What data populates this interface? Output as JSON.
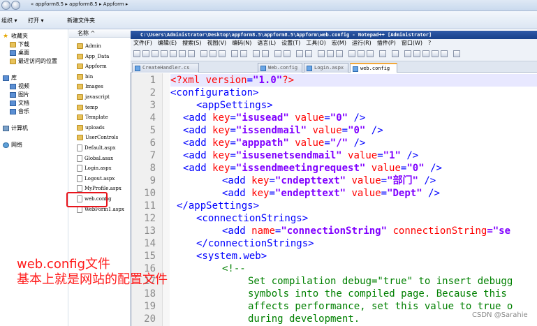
{
  "explorer": {
    "path": "« appform8.5 ▸ appform8.5 ▸ Appform ▸",
    "toolbar": {
      "organize": "组织 ▾",
      "open": "打开 ▾",
      "new_folder": "新建文件夹"
    },
    "nav": [
      {
        "label": "收藏夹",
        "icon": "star-icon"
      },
      {
        "label": "下载",
        "icon": "folder-icon"
      },
      {
        "label": "桌面",
        "icon": "folder-icon"
      },
      {
        "label": "最近访问的位置",
        "icon": "folder-icon"
      },
      {
        "label": "库",
        "icon": "library-icon"
      },
      {
        "label": "视频",
        "icon": "folder-icon"
      },
      {
        "label": "图片",
        "icon": "folder-icon"
      },
      {
        "label": "文档",
        "icon": "folder-icon"
      },
      {
        "label": "音乐",
        "icon": "folder-icon"
      },
      {
        "label": "计算机",
        "icon": "computer-icon"
      },
      {
        "label": "网络",
        "icon": "network-icon"
      }
    ],
    "file_header": "名称 ^",
    "files": [
      {
        "name": "Admin",
        "kind": "folder"
      },
      {
        "name": "App_Data",
        "kind": "folder"
      },
      {
        "name": "Appform",
        "kind": "folder"
      },
      {
        "name": "bin",
        "kind": "folder"
      },
      {
        "name": "Images",
        "kind": "folder"
      },
      {
        "name": "javascript",
        "kind": "folder"
      },
      {
        "name": "temp",
        "kind": "folder"
      },
      {
        "name": "Template",
        "kind": "folder"
      },
      {
        "name": "uploads",
        "kind": "folder"
      },
      {
        "name": "UserControls",
        "kind": "folder"
      },
      {
        "name": "Default.aspx",
        "kind": "file"
      },
      {
        "name": "Global.asax",
        "kind": "file"
      },
      {
        "name": "Login.aspx",
        "kind": "file"
      },
      {
        "name": "Logout.aspx",
        "kind": "file"
      },
      {
        "name": "MyProfile.aspx",
        "kind": "file"
      },
      {
        "name": "web.config",
        "kind": "file"
      },
      {
        "name": "WebForm1.aspx",
        "kind": "file"
      }
    ]
  },
  "notepad": {
    "title": "C:\\Users\\Administrator\\Desktop\\appform8.5\\appform8.5\\Appform\\web.config - Notepad++ [Administrator]",
    "menu": [
      "文件(F)",
      "编辑(E)",
      "搜索(S)",
      "视图(V)",
      "编码(N)",
      "语言(L)",
      "设置(T)",
      "工具(O)",
      "宏(M)",
      "运行(R)",
      "插件(P)",
      "窗口(W)",
      "?"
    ],
    "tabs": [
      {
        "label": "CreateHandler.cs",
        "active": false
      },
      {
        "label": "Web.config",
        "active": false
      },
      {
        "label": "Login.aspx",
        "active": false
      },
      {
        "label": "web.config",
        "active": true
      }
    ],
    "line_numbers": [
      "1",
      "2",
      "3",
      "4",
      "5",
      "6",
      "7",
      "8",
      "9",
      "10",
      "11",
      "12",
      "13",
      "14",
      "15",
      "16",
      "17",
      "18",
      "19",
      "20"
    ]
  },
  "caption": {
    "line1": "web.config文件",
    "line2": "基本上就是网站的配置文件"
  },
  "watermark": "CSDN @Sarahie",
  "code": {
    "l1_a": "<?xml ",
    "l1_b": "version",
    "l1_c": "=",
    "l1_d": "\"1.0\"",
    "l1_e": "?>",
    "l2": "<configuration>",
    "l3": "<appSettings>",
    "l4_k": "\"isusead\"",
    "l4_v": "\"0\"",
    "l5_k": "\"issendmail\"",
    "l5_v": "\"0\"",
    "l6_k": "\"apppath\"",
    "l6_v": "\"/\"",
    "l7_k": "\"isusenetsendmail\"",
    "l7_v": "\"1\"",
    "l8_k": "\"issendmeetingrequest\"",
    "l8_v": "\"0\"",
    "l9_k": "\"cndepttext\"",
    "l9_v": "\"部门\"",
    "l10_k": "\"endepttext\"",
    "l10_v": "\"Dept\"",
    "l11": "</appSettings>",
    "l12": "<connectionStrings>",
    "l13_n": "\"connectionString\"",
    "l13_c": "connectionString",
    "l14": "</connectionStrings>",
    "l15": "<system.web>",
    "l16": "<!--",
    "l17": "Set compilation debug=\"true\" to insert debugg",
    "l18": "symbols into the compiled page. Because this",
    "l19": "affects performance, set this value to true o",
    "l20": "during development.",
    "add": "<add ",
    "key": "key",
    "value": "value",
    "name": "name",
    "eq": "=",
    "close": " />",
    "trunc": "=\"se"
  }
}
